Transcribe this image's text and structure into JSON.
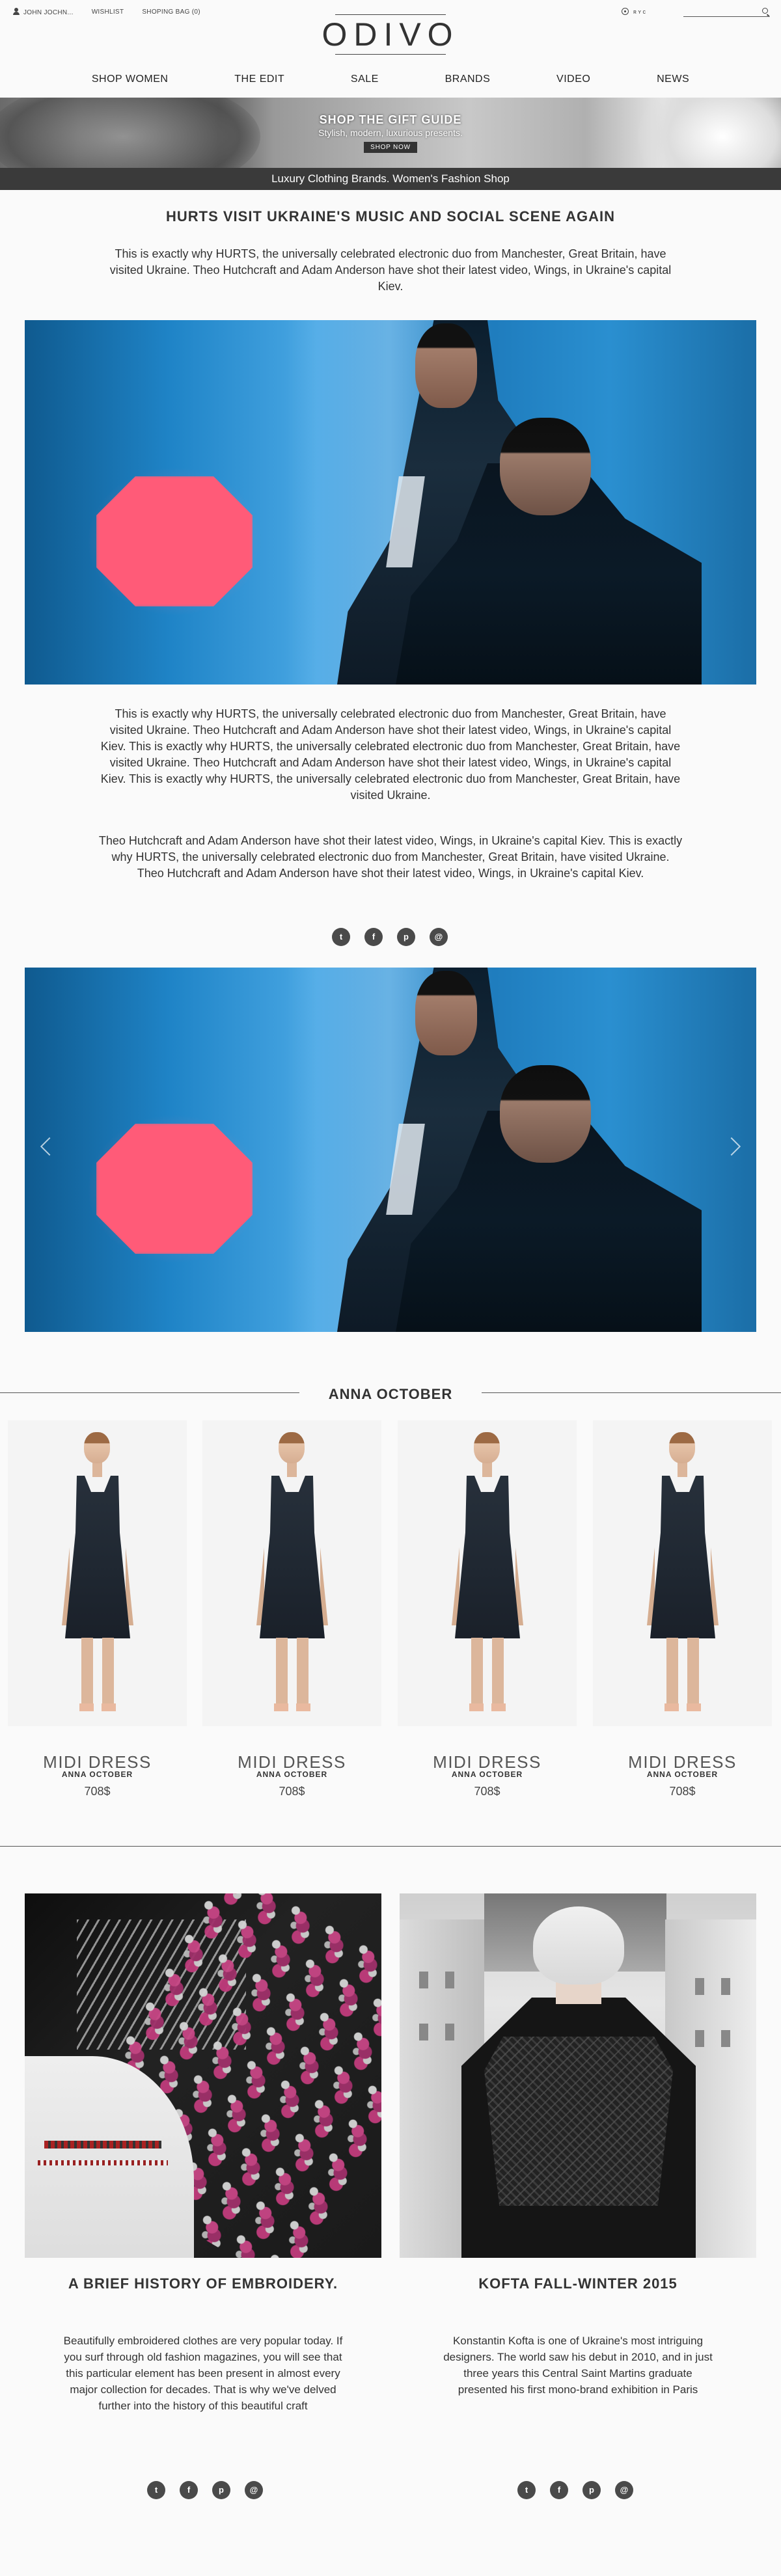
{
  "topbar": {
    "user": "JOHN JOCHN...",
    "wishlist": "WISHLIST",
    "bag": "SHOPING BAG (0)",
    "langs": [
      "",
      ""
    ],
    "extra": "ʀ ʏ ᴄ"
  },
  "logo": "ODIVO",
  "nav": [
    "SHOP WOMEN",
    "THE EDIT",
    "SALE",
    "BRANDS",
    "VIDEO",
    "NEWS"
  ],
  "banner": {
    "heading": "SHOP THE GIFT GUIDE",
    "sub": "Stylish, modern, luxurious presents.",
    "button": "SHOP NOW"
  },
  "strip": "Luxury Clothing Brands. Women's Fashion Shop",
  "article": {
    "title": "HURTS VISIT UKRAINE'S MUSIC AND SOCIAL SCENE AGAIN",
    "intro": "This is exactly why HURTS, the universally celebrated electronic duo from Manchester, Great Britain, have visited Ukraine. Theo Hutchcraft and Adam Anderson have shot their latest video, Wings, in Ukraine's capital Kiev.",
    "p1": "This is exactly why HURTS, the universally celebrated electronic duo from Manchester, Great Britain, have visited Ukraine. Theo Hutchcraft and Adam Anderson have shot their latest video, Wings, in Ukraine's capital Kiev. This is exactly why HURTS, the universally celebrated electronic duo from Manchester, Great Britain, have visited Ukraine. Theo Hutchcraft and Adam Anderson have shot their latest video, Wings, in Ukraine's capital Kiev. This is exactly why HURTS, the universally celebrated electronic duo from Manchester, Great Britain, have visited Ukraine.",
    "p2": "Theo Hutchcraft and Adam Anderson have shot their latest video, Wings, in Ukraine's capital Kiev. This is exactly why HURTS, the universally celebrated electronic duo from Manchester, Great Britain, have visited Ukraine. Theo Hutchcraft and Adam Anderson have shot their latest video, Wings, in Ukraine's capital Kiev."
  },
  "social": [
    "twitter-icon",
    "facebook-icon",
    "pinterest-icon",
    "email-icon"
  ],
  "social_glyphs": [
    "t",
    "f",
    "p",
    "@"
  ],
  "section": {
    "title": "ANNA OCTOBER"
  },
  "products": [
    {
      "name": "MIDI DRESS",
      "brand": "ANNA OCTOBER",
      "price": "708$"
    },
    {
      "name": "MIDI DRESS",
      "brand": "ANNA OCTOBER",
      "price": "708$"
    },
    {
      "name": "MIDI DRESS",
      "brand": "ANNA OCTOBER",
      "price": "708$"
    },
    {
      "name": "MIDI DRESS",
      "brand": "ANNA OCTOBER",
      "price": "708$"
    }
  ],
  "articles": [
    {
      "title": "A BRIEF HISTORY OF EMBROIDERY.",
      "text": "Beautifully embroidered clothes are very popular today. If you surf through old fashion magazines, you will see that this particular element has been present in almost every major collection for decades. That is why we've delved further into the history of this beautiful craft"
    },
    {
      "title": "KOFTA FALL-WINTER 2015",
      "text": "Konstantin Kofta is one of Ukraine's most intriguing designers. The world saw his debut in 2010, and in just three years this Central Saint Martins graduate presented his first mono-brand exhibition in Paris"
    }
  ]
}
